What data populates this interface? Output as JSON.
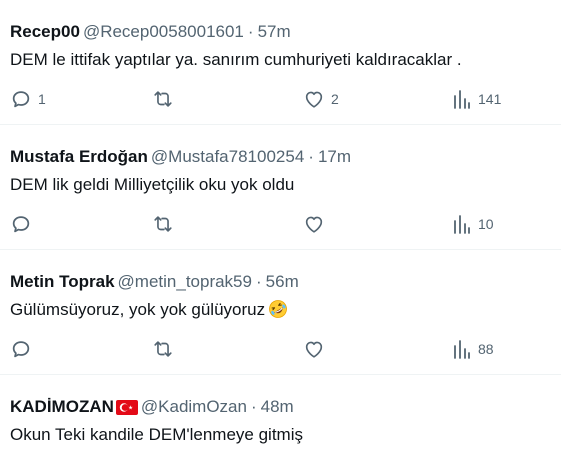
{
  "tweets": [
    {
      "name": "Recep00",
      "handle": "@Recep0058001601",
      "separator": "·",
      "time": "57m",
      "text": "DEM le ittifak yaptılar ya. sanırım cumhuriyeti kaldıracaklar .",
      "replies": "1",
      "retweets": "",
      "likes": "2",
      "views": "141"
    },
    {
      "name": "Mustafa Erdoğan",
      "handle": "@Mustafa78100254",
      "separator": "·",
      "time": "17m",
      "text": "DEM lik geldi Milliyetçilik oku yok oldu",
      "replies": "",
      "retweets": "",
      "likes": "",
      "views": "10"
    },
    {
      "name": "Metin Toprak",
      "handle": "@metin_toprak59",
      "separator": "·",
      "time": "56m",
      "text": "Gülümsüyoruz, yok yok gülüyoruz",
      "emoji": "rolling-on-the-floor-laughing-emoji",
      "replies": "",
      "retweets": "",
      "likes": "",
      "views": "88"
    },
    {
      "name": "KADİMOZAN",
      "flag": "turkey-flag-icon",
      "handle": "@KadimOzan",
      "separator": "·",
      "time": "48m",
      "text": "Okun Teki kandile DEM'lenmeye gitmiş"
    }
  ],
  "icons": {
    "reply": "reply-bubble-icon",
    "retweet": "retweet-icon",
    "like": "heart-icon",
    "views": "views-bar-icon"
  },
  "colors": {
    "text": "#0f1419",
    "secondary": "#536471",
    "divider": "#eff3f4",
    "flag_red": "#e30a17"
  }
}
